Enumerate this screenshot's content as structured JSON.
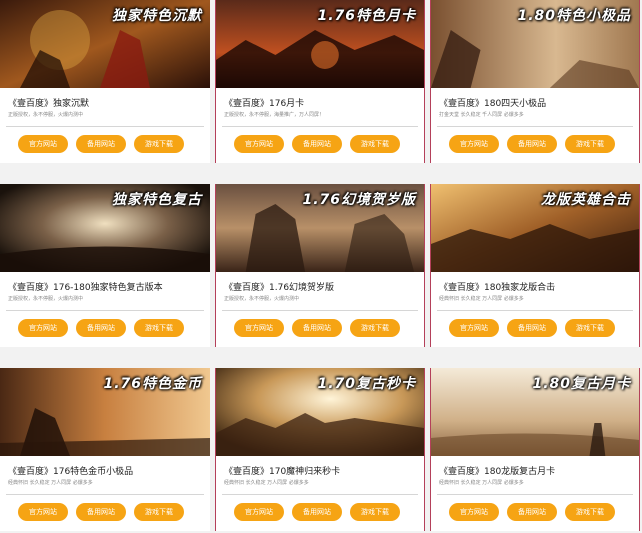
{
  "palette": {
    "button": "#f6a414",
    "accent_border": "#b4405a",
    "title": "#222222",
    "subtitle": "#888888"
  },
  "cards": [
    {
      "banner": "独家特色沉默",
      "title": "《壹百度》独家沉默",
      "subtitle": "正版授权，永不停服，火爆内测中",
      "buttons": [
        "官方网站",
        "备用网站",
        "游戏下载"
      ]
    },
    {
      "banner": "1.76特色月卡",
      "title": "《壹百度》176月卡",
      "subtitle": "正版授权，永不停服，海量推广，万人同屏！",
      "buttons": [
        "官方网站",
        "备用网站",
        "游戏下载"
      ]
    },
    {
      "banner": "1.80特色小极品",
      "title": "《壹百度》180四天小极品",
      "subtitle": "打金天堂 长久稳定 千人同屏 必爆多多",
      "buttons": [
        "官方网站",
        "备用网站",
        "游戏下载"
      ]
    },
    {
      "banner": "独家特色复古",
      "title": "《壹百度》176-180独家特色复古版本",
      "subtitle": "正版授权，永不停服，火爆内测中",
      "buttons": [
        "官方网站",
        "备用网站",
        "游戏下载"
      ]
    },
    {
      "banner": "1.76幻境贺岁版",
      "title": "《壹百度》1.76幻境贺岁版",
      "subtitle": "正版授权，永不停服，火爆内测中",
      "buttons": [
        "官方网站",
        "备用网站",
        "游戏下载"
      ]
    },
    {
      "banner": "龙版英雄合击",
      "title": "《壹百度》180独家龙版合击",
      "subtitle": "经典怀旧 长久稳定 万人同屏 必爆多多",
      "buttons": [
        "官方网站",
        "备用网站",
        "游戏下载"
      ]
    },
    {
      "banner": "1.76特色金币",
      "title": "《壹百度》176特色金币小极品",
      "subtitle": "经典怀旧 长久稳定 万人同屏 必爆多多",
      "buttons": [
        "官方网站",
        "备用网站",
        "游戏下载"
      ]
    },
    {
      "banner": "1.70复古秒卡",
      "title": "《壹百度》170魔神归来秒卡",
      "subtitle": "经典怀旧 长久稳定 万人同屏 必爆多多",
      "buttons": [
        "官方网站",
        "备用网站",
        "游戏下载"
      ]
    },
    {
      "banner": "1.80复古月卡",
      "title": "《壹百度》180龙版复古月卡",
      "subtitle": "经典怀旧 长久稳定 万人同屏 必爆多多",
      "buttons": [
        "官方网站",
        "备用网站",
        "游戏下载"
      ]
    }
  ]
}
